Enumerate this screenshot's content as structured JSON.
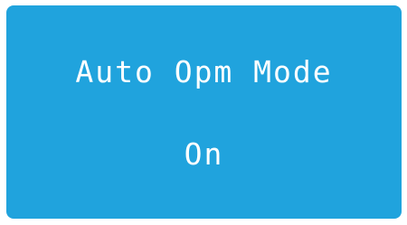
{
  "panel": {
    "title": "Auto Opm Mode",
    "value": "On",
    "background_color": "#20a3dd",
    "text_color": "#ffffff"
  }
}
